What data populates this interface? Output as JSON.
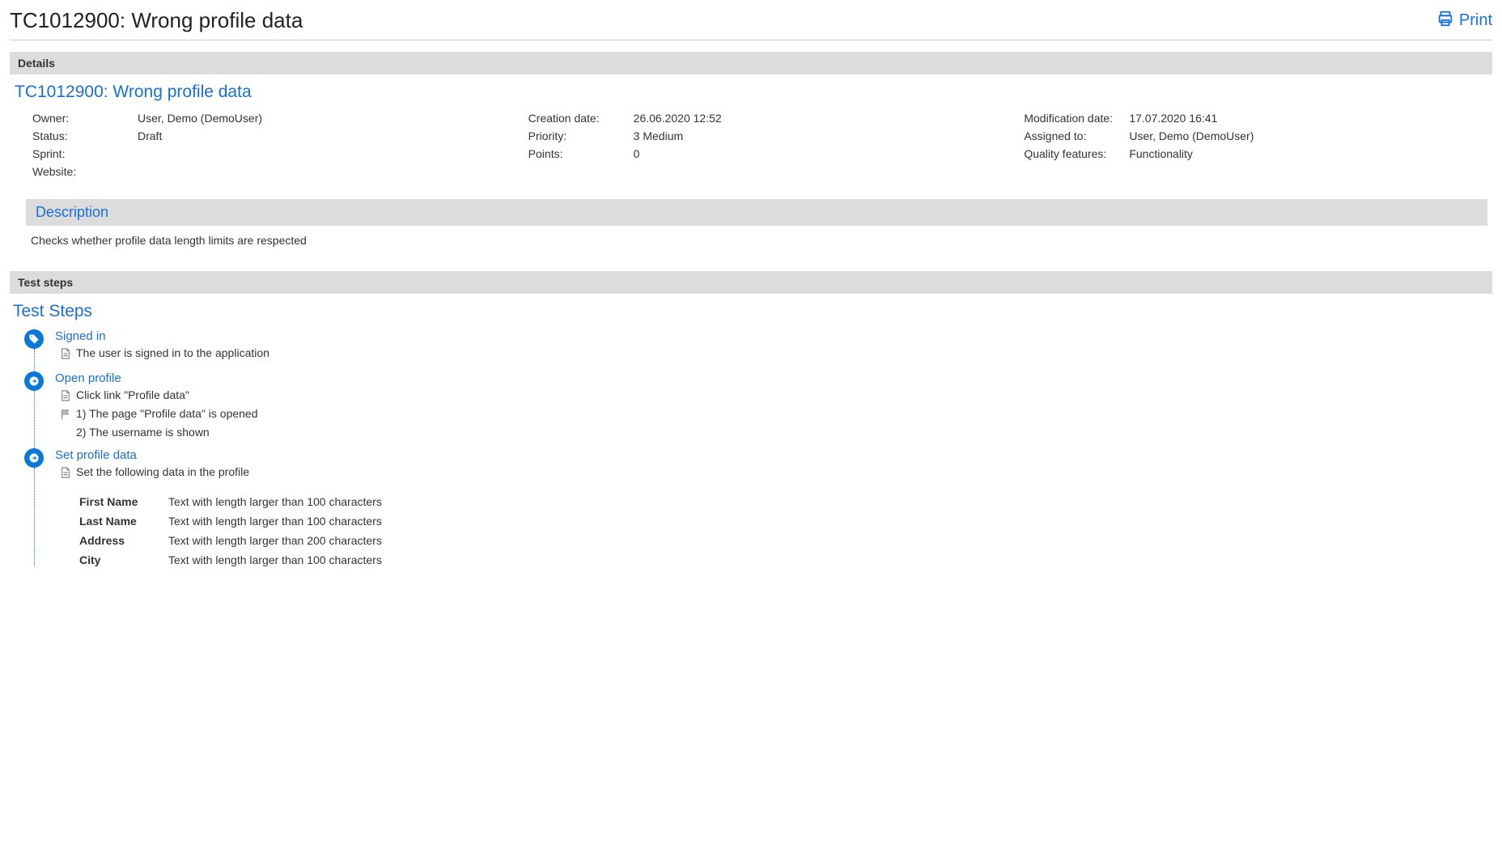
{
  "header": {
    "title": "TC1012900: Wrong profile data",
    "print_label": "Print"
  },
  "sections": {
    "details_bar": "Details",
    "teststeps_bar": "Test steps"
  },
  "details": {
    "title": "TC1012900: Wrong profile data",
    "col1": [
      {
        "label": "Owner:",
        "value": "User, Demo (DemoUser)"
      },
      {
        "label": "Status:",
        "value": "Draft"
      },
      {
        "label": "Sprint:",
        "value": ""
      },
      {
        "label": "Website:",
        "value": ""
      }
    ],
    "col2": [
      {
        "label": "Creation date:",
        "value": "26.06.2020 12:52"
      },
      {
        "label": "Priority:",
        "value": "3 Medium"
      },
      {
        "label": "Points:",
        "value": "0"
      }
    ],
    "col3": [
      {
        "label": "Modification date:",
        "value": "17.07.2020 16:41"
      },
      {
        "label": "Assigned to:",
        "value": "User, Demo (DemoUser)"
      },
      {
        "label": "Quality features:",
        "value": "Functionality"
      }
    ],
    "description_heading": "Description",
    "description_text": "Checks whether profile data length limits are respected"
  },
  "teststeps": {
    "title": "Test Steps",
    "steps": [
      {
        "icon": "tag",
        "title": "Signed in",
        "lines": [
          {
            "icon": "doc",
            "text": "The user is signed in to the application"
          }
        ]
      },
      {
        "icon": "arrow",
        "title": "Open profile",
        "lines": [
          {
            "icon": "doc",
            "text": "Click link \"Profile data\""
          },
          {
            "icon": "flag",
            "text": "1) The page \"Profile data\" is opened"
          },
          {
            "icon": "",
            "text": "2) The username is shown"
          }
        ]
      },
      {
        "icon": "arrow",
        "title": "Set profile data",
        "lines": [
          {
            "icon": "doc",
            "text": "Set the following data in the profile"
          }
        ],
        "table": [
          {
            "key": "First Name",
            "value": "Text with length larger than 100 characters"
          },
          {
            "key": "Last Name",
            "value": "Text with length larger than 100 characters"
          },
          {
            "key": "Address",
            "value": "Text with length larger than 200 characters"
          },
          {
            "key": "City",
            "value": "Text with length larger than 100 characters"
          }
        ]
      }
    ]
  }
}
